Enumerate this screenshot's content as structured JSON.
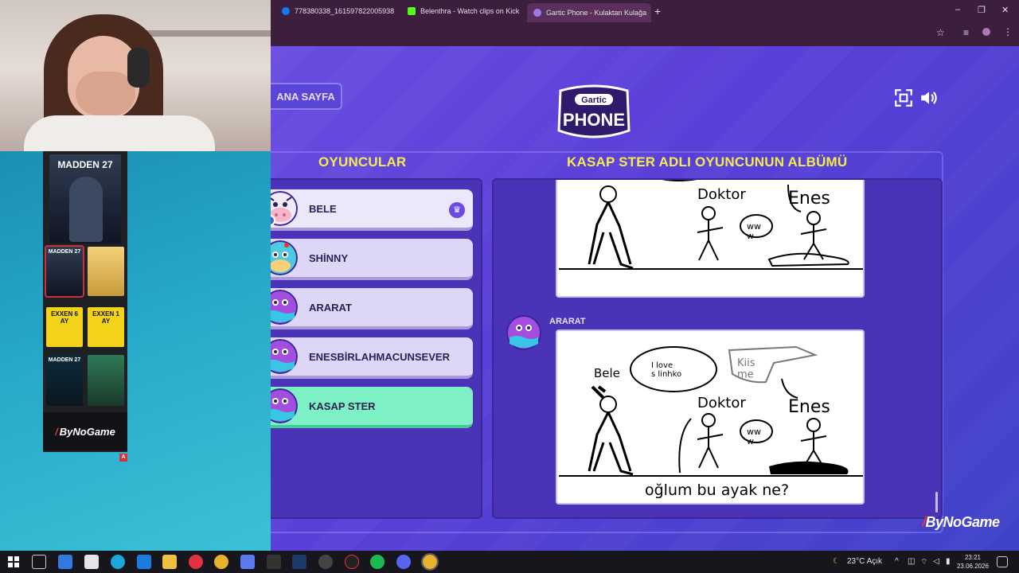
{
  "browser": {
    "tabs": [
      {
        "label": "778380338_161597822005938",
        "favicon_color": "#1877f2",
        "active": false
      },
      {
        "label": "Belenthra - Watch clips on Kick",
        "favicon_color": "#53fc18",
        "active": false
      },
      {
        "label": "Gartic Phone - Kulaktan Kulağa",
        "favicon_color": "#a274f2",
        "active": true
      }
    ],
    "new_tab": "+",
    "window_controls": [
      "–",
      "❐",
      "✕"
    ],
    "toolbar_icons": [
      "star-icon",
      "playlist-icon",
      "profile-icon",
      "menu-icon"
    ]
  },
  "overlay": {
    "store_items": [
      {
        "title": "MADDEN 27",
        "kind": "large"
      },
      {
        "title": "MADDEN 27",
        "kind": "small-selected"
      },
      {
        "title": "",
        "kind": "gold"
      },
      {
        "title": "EXXEN 6 AY",
        "kind": "exxen"
      },
      {
        "title": "EXXEN 1 AY",
        "kind": "exxen"
      },
      {
        "title": "MADDEN 27",
        "kind": "small"
      },
      {
        "title": "",
        "kind": "fifa"
      }
    ],
    "brand": "ByNoGame",
    "badge": "A",
    "watermark": "ByNoGame"
  },
  "gartic": {
    "back_label": "ANA SAYFA",
    "logo_top": "Gartic",
    "logo_bottom": "PHONE",
    "players_title": "OYUNCULAR",
    "album_title": "KASAP STER ADLI OYUNCUNUN ALBÜMÜ",
    "players": [
      {
        "name": "BELE",
        "avatar": "cow",
        "host": true,
        "current": false
      },
      {
        "name": "SHİNNY",
        "avatar": "cyan",
        "host": false,
        "current": false
      },
      {
        "name": "ARARAT",
        "avatar": "purple",
        "host": false,
        "current": false
      },
      {
        "name": "ENESBİRLAHMACUNSEVER",
        "avatar": "purple",
        "host": false,
        "current": false
      },
      {
        "name": "KASAP STER",
        "avatar": "purple",
        "host": false,
        "current": true
      }
    ],
    "album_author": "ARARAT",
    "drawing_texts": {
      "doctor": "Doktor",
      "enes": "Enes",
      "bele": "Bele",
      "speech_left": "I love\ns linhko",
      "speech_right": "Kiis\nme",
      "ww": "ww\nw",
      "caption": "oğlum bu ayak ne?"
    },
    "colors": {
      "title_yellow": "#f5ec4b",
      "current_player": "#7ef0c5",
      "page_bg": "#5a3fd8"
    }
  },
  "taskbar": {
    "weather": "23°C Açık",
    "time": "23:21",
    "date": "23.06.2026"
  }
}
